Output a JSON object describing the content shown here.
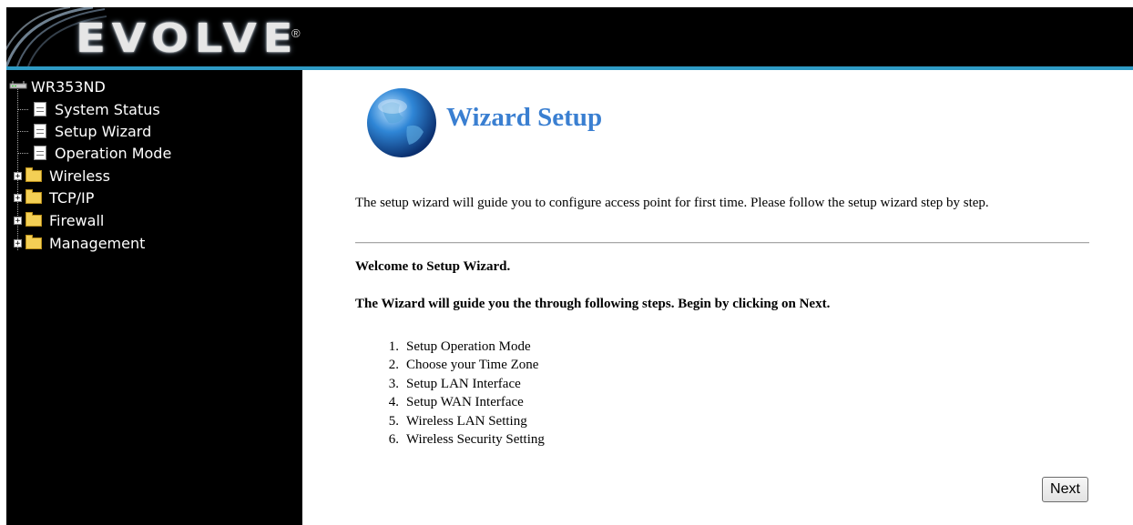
{
  "header": {
    "brand": "EVOLVE",
    "registered": "®"
  },
  "sidebar": {
    "root": "WR353ND",
    "pages": [
      "System Status",
      "Setup Wizard",
      "Operation Mode"
    ],
    "folders": [
      "Wireless",
      "TCP/IP",
      "Firewall",
      "Management"
    ],
    "expander_symbol": "+"
  },
  "main": {
    "title": "Wizard Setup",
    "intro": "The setup wizard will guide you to configure access point for first time. Please follow the setup wizard step by step.",
    "welcome": "Welcome to Setup Wizard.",
    "guide": "The Wizard will guide you the through following steps. Begin by clicking on Next.",
    "steps": [
      {
        "num": "1.",
        "label": "Setup Operation Mode"
      },
      {
        "num": "2.",
        "label": "Choose your Time Zone"
      },
      {
        "num": "3.",
        "label": "Setup LAN Interface"
      },
      {
        "num": "4.",
        "label": "Setup WAN Interface"
      },
      {
        "num": "5.",
        "label": "Wireless LAN Setting"
      },
      {
        "num": "6.",
        "label": "Wireless Security Setting"
      }
    ],
    "next_label": "Next"
  },
  "colors": {
    "accent_bar": "#2f9bc5",
    "title": "#3a7fd1",
    "sidebar_bg": "#000000"
  }
}
